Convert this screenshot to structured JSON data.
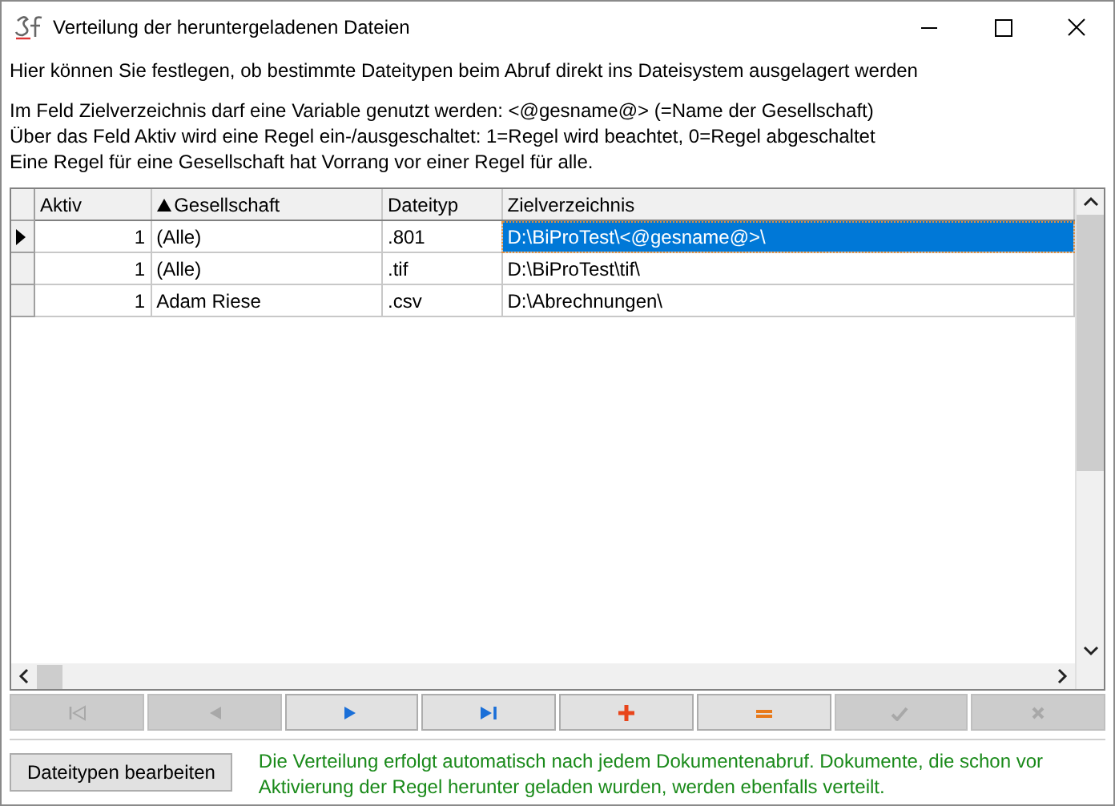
{
  "window": {
    "title": "Verteilung der heruntergeladenen Dateien"
  },
  "intro": "Hier können Sie festlegen, ob bestimmte Dateitypen beim Abruf direkt ins Dateisystem ausgelagert werden",
  "notes": [
    "Im Feld Zielverzeichnis darf eine Variable genutzt werden: <@gesname@> (=Name der Gesellschaft)",
    "Über das Feld Aktiv wird eine Regel ein-/ausgeschaltet: 1=Regel wird beachtet, 0=Regel abgeschaltet",
    "Eine Regel für eine Gesellschaft hat Vorrang vor einer Regel für alle."
  ],
  "table": {
    "columns": [
      {
        "label": "Aktiv",
        "sorted": false,
        "focused": false
      },
      {
        "label": "Gesellschaft",
        "sorted": true,
        "focused": false
      },
      {
        "label": "Dateityp",
        "sorted": false,
        "focused": false
      },
      {
        "label": "Zielverzeichnis",
        "sorted": false,
        "focused": true
      }
    ],
    "rows": [
      {
        "selected": true,
        "cells": [
          "1",
          "(Alle)",
          ".801",
          "D:\\BiProTest\\<@gesname@>\\"
        ]
      },
      {
        "selected": false,
        "cells": [
          "1",
          "(Alle)",
          ".tif",
          "D:\\BiProTest\\tif\\"
        ]
      },
      {
        "selected": false,
        "cells": [
          "1",
          "Adam Riese",
          ".csv",
          "D:\\Abrechnungen\\"
        ]
      }
    ]
  },
  "navigator": [
    {
      "kind": "first",
      "disabled": true
    },
    {
      "kind": "prior",
      "disabled": true
    },
    {
      "kind": "next",
      "disabled": false
    },
    {
      "kind": "last",
      "disabled": false
    },
    {
      "kind": "insert",
      "disabled": false
    },
    {
      "kind": "delete",
      "disabled": false
    },
    {
      "kind": "post",
      "disabled": true
    },
    {
      "kind": "cancel",
      "disabled": true
    }
  ],
  "edit_button": "Dateitypen bearbeiten",
  "info": "Die Verteilung erfolgt automatisch nach jedem Dokumentenabruf. Dokumente, die schon vor Aktivierung der Regel herunter geladen wurden, werden ebenfalls verteilt."
}
